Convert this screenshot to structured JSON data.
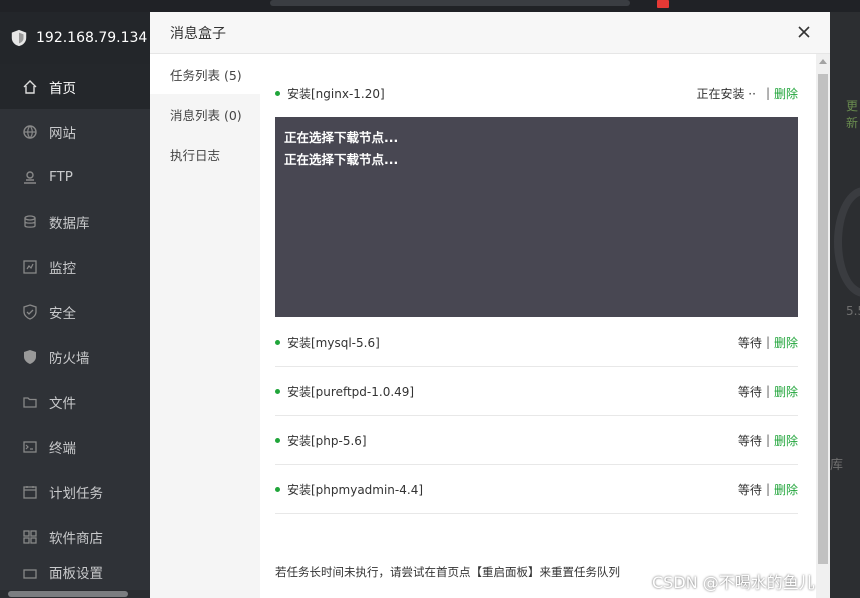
{
  "server": {
    "ip": "192.168.79.134"
  },
  "sidebar": {
    "items": [
      {
        "label": "首页",
        "icon": "home-icon"
      },
      {
        "label": "网站",
        "icon": "globe-icon"
      },
      {
        "label": "FTP",
        "icon": "ftp-icon"
      },
      {
        "label": "数据库",
        "icon": "database-icon"
      },
      {
        "label": "监控",
        "icon": "monitor-icon"
      },
      {
        "label": "安全",
        "icon": "shield-check-icon"
      },
      {
        "label": "防火墙",
        "icon": "firewall-icon"
      },
      {
        "label": "文件",
        "icon": "folder-icon"
      },
      {
        "label": "终端",
        "icon": "terminal-icon"
      },
      {
        "label": "计划任务",
        "icon": "calendar-icon"
      },
      {
        "label": "软件商店",
        "icon": "apps-icon"
      },
      {
        "label": "面板设置",
        "icon": "settings-icon"
      }
    ]
  },
  "background": {
    "more": "更新",
    "value": "5.5",
    "db": "库"
  },
  "modal": {
    "title": "消息盒子",
    "tabs": [
      {
        "label": "任务列表 (5)"
      },
      {
        "label": "消息列表 (0)"
      },
      {
        "label": "执行日志"
      }
    ],
    "first_task": {
      "name": "安装[nginx-1.20]",
      "status": "正在安装 ··",
      "separator": "|",
      "delete": "删除"
    },
    "console_lines": [
      "正在选择下载节点...",
      "正在选择下载节点..."
    ],
    "tasks": [
      {
        "name": "安装[mysql-5.6]",
        "status": "等待",
        "separator": "|",
        "delete": "删除"
      },
      {
        "name": "安装[pureftpd-1.0.49]",
        "status": "等待",
        "separator": "|",
        "delete": "删除"
      },
      {
        "name": "安装[php-5.6]",
        "status": "等待",
        "separator": "|",
        "delete": "删除"
      },
      {
        "name": "安装[phpmyadmin-4.4]",
        "status": "等待",
        "separator": "|",
        "delete": "删除"
      }
    ],
    "footer_note": "若任务长时间未执行，请尝试在首页点【重启面板】来重置任务队列"
  },
  "watermark": "CSDN @不喝水的鱼儿",
  "colors": {
    "accent": "#20a53a",
    "console_bg": "#484752",
    "sidebar_bg": "#2f3237"
  }
}
